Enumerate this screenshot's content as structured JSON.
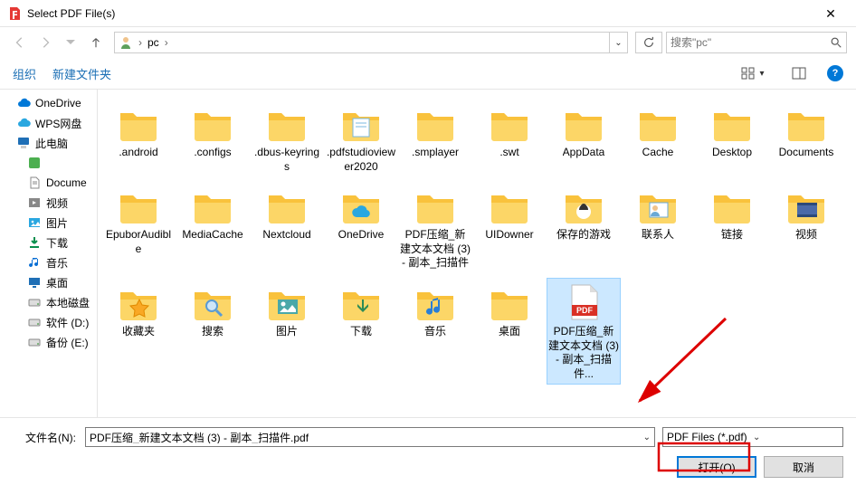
{
  "window": {
    "title": "Select PDF File(s)"
  },
  "nav": {
    "breadcrumb": {
      "segments": [
        "pc"
      ]
    },
    "search_placeholder": "搜索\"pc\""
  },
  "toolbar": {
    "organize": "组织",
    "newfolder": "新建文件夹"
  },
  "sidebar": {
    "items": [
      {
        "label": "OneDrive",
        "icon": "cloud",
        "color": "#0078d7"
      },
      {
        "label": "WPS网盘",
        "icon": "cloud",
        "color": "#2aa7e0"
      },
      {
        "label": "此电脑",
        "icon": "monitor",
        "color": "#1f6fb6"
      },
      {
        "label": "",
        "icon": "square",
        "color": "#4caf50",
        "indent": true
      },
      {
        "label": "Docume",
        "icon": "doc",
        "color": "#888",
        "indent": true
      },
      {
        "label": "视频",
        "icon": "video",
        "color": "#888",
        "indent": true
      },
      {
        "label": "图片",
        "icon": "image",
        "color": "#2aa7e0",
        "indent": true
      },
      {
        "label": "下载",
        "icon": "download",
        "color": "#0a8f4e",
        "indent": true
      },
      {
        "label": "音乐",
        "icon": "music",
        "color": "#0a6fd4",
        "indent": true
      },
      {
        "label": "桌面",
        "icon": "desktop",
        "color": "#1f6fb6",
        "indent": true
      },
      {
        "label": "本地磁盘",
        "icon": "disk",
        "color": "#888",
        "indent": true
      },
      {
        "label": "软件 (D:)",
        "icon": "disk",
        "color": "#888",
        "indent": true
      },
      {
        "label": "备份 (E:)",
        "icon": "disk",
        "color": "#888",
        "indent": true
      }
    ]
  },
  "files": [
    {
      "label": ".android",
      "type": "folder"
    },
    {
      "label": ".configs",
      "type": "folder"
    },
    {
      "label": ".dbus-keyrings",
      "type": "folder"
    },
    {
      "label": ".pdfstudioviewer2020",
      "type": "folder-content"
    },
    {
      "label": ".smplayer",
      "type": "folder"
    },
    {
      "label": ".swt",
      "type": "folder"
    },
    {
      "label": "AppData",
      "type": "folder"
    },
    {
      "label": "Cache",
      "type": "folder"
    },
    {
      "label": "Desktop",
      "type": "folder"
    },
    {
      "label": "Documents",
      "type": "folder"
    },
    {
      "label": "EpuborAudible",
      "type": "folder"
    },
    {
      "label": "MediaCache",
      "type": "folder"
    },
    {
      "label": "Nextcloud",
      "type": "folder"
    },
    {
      "label": "OneDrive",
      "type": "folder-cloud"
    },
    {
      "label": "PDF压缩_新建文本文档 (3) - 副本_扫描件",
      "type": "folder"
    },
    {
      "label": "UIDowner",
      "type": "folder"
    },
    {
      "label": "保存的游戏",
      "type": "folder-games"
    },
    {
      "label": "联系人",
      "type": "folder-contacts"
    },
    {
      "label": "链接",
      "type": "folder"
    },
    {
      "label": "视频",
      "type": "folder-video"
    },
    {
      "label": "收藏夹",
      "type": "folder-favs"
    },
    {
      "label": "搜索",
      "type": "folder-search"
    },
    {
      "label": "图片",
      "type": "folder-image"
    },
    {
      "label": "下载",
      "type": "folder-download"
    },
    {
      "label": "音乐",
      "type": "folder-music"
    },
    {
      "label": "桌面",
      "type": "folder"
    },
    {
      "label": "PDF压缩_新建文本文档 (3) - 副本_扫描件...",
      "type": "pdf",
      "selected": true
    }
  ],
  "footer": {
    "filename_label": "文件名(N):",
    "filename_value": "PDF压缩_新建文本文档 (3) - 副本_扫描件.pdf",
    "filetype": "PDF Files (*.pdf)",
    "open": "打开(O)",
    "cancel": "取消"
  }
}
